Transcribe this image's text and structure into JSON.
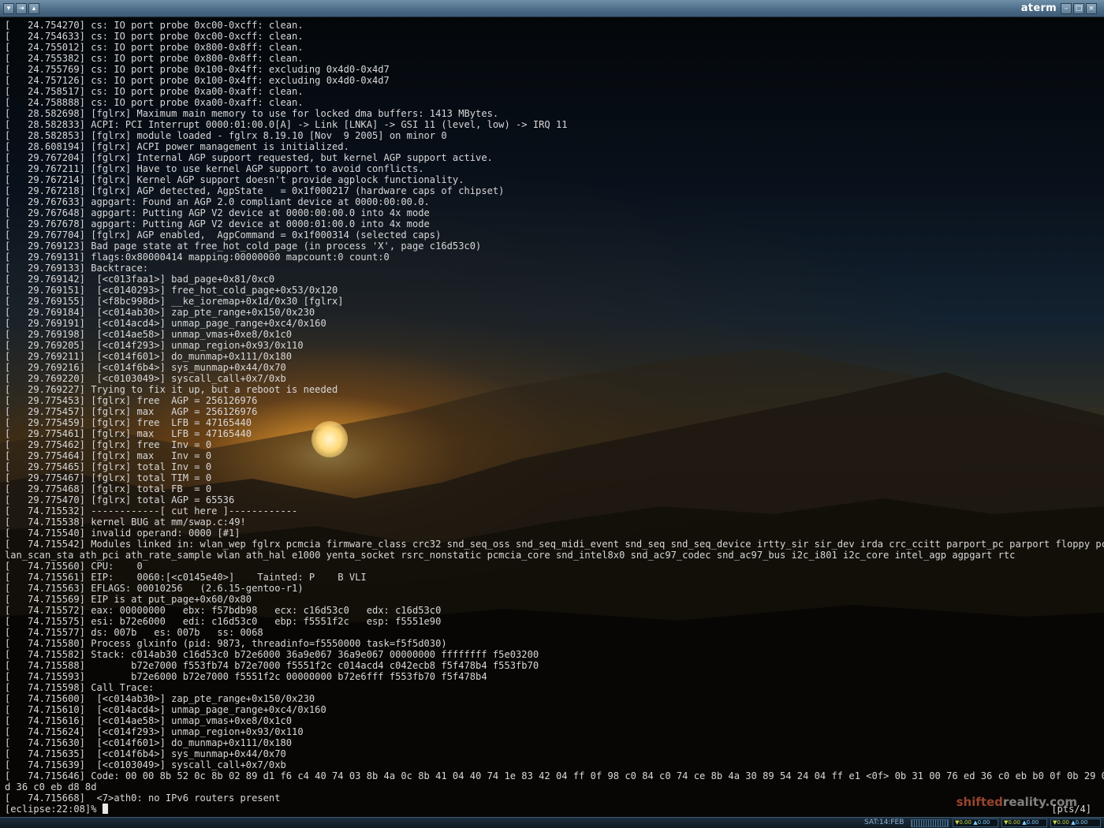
{
  "window": {
    "title": "aterm",
    "left_buttons": [
      "▾",
      "⇥",
      "▴"
    ],
    "right_buttons": [
      "–",
      "□",
      "×"
    ]
  },
  "terminal": {
    "lines": [
      "[   24.754270] cs: IO port probe 0xc00-0xcff: clean.",
      "[   24.754633] cs: IO port probe 0xc00-0xcff: clean.",
      "[   24.755012] cs: IO port probe 0x800-0x8ff: clean.",
      "[   24.755382] cs: IO port probe 0x800-0x8ff: clean.",
      "[   24.755769] cs: IO port probe 0x100-0x4ff: excluding 0x4d0-0x4d7",
      "[   24.757126] cs: IO port probe 0x100-0x4ff: excluding 0x4d0-0x4d7",
      "[   24.758517] cs: IO port probe 0xa00-0xaff: clean.",
      "[   24.758888] cs: IO port probe 0xa00-0xaff: clean.",
      "[   28.582698] [fglrx] Maximum main memory to use for locked dma buffers: 1413 MBytes.",
      "[   28.582833] ACPI: PCI Interrupt 0000:01:00.0[A] -> Link [LNKA] -> GSI 11 (level, low) -> IRQ 11",
      "[   28.582853] [fglrx] module loaded - fglrx 8.19.10 [Nov  9 2005] on minor 0",
      "[   28.608194] [fglrx] ACPI power management is initialized.",
      "[   29.767204] [fglrx] Internal AGP support requested, but kernel AGP support active.",
      "[   29.767211] [fglrx] Have to use kernel AGP support to avoid conflicts.",
      "[   29.767214] [fglrx] Kernel AGP support doesn't provide agplock functionality.",
      "[   29.767218] [fglrx] AGP detected, AgpState   = 0x1f000217 (hardware caps of chipset)",
      "[   29.767633] agpgart: Found an AGP 2.0 compliant device at 0000:00:00.0.",
      "[   29.767648] agpgart: Putting AGP V2 device at 0000:00:00.0 into 4x mode",
      "[   29.767678] agpgart: Putting AGP V2 device at 0000:01:00.0 into 4x mode",
      "[   29.767704] [fglrx] AGP enabled,  AgpCommand = 0x1f000314 (selected caps)",
      "[   29.769123] Bad page state at free_hot_cold_page (in process 'X', page c16d53c0)",
      "[   29.769131] flags:0x80000414 mapping:00000000 mapcount:0 count:0",
      "[   29.769133] Backtrace:",
      "[   29.769142]  [<c013faa1>] bad_page+0x81/0xc0",
      "[   29.769151]  [<c0140293>] free_hot_cold_page+0x53/0x120",
      "[   29.769155]  [<f8bc998d>] __ke_ioremap+0x1d/0x30 [fglrx]",
      "[   29.769184]  [<c014ab30>] zap_pte_range+0x150/0x230",
      "[   29.769191]  [<c014acd4>] unmap_page_range+0xc4/0x160",
      "[   29.769198]  [<c014ae58>] unmap_vmas+0xe8/0x1c0",
      "[   29.769205]  [<c014f293>] unmap_region+0x93/0x110",
      "[   29.769211]  [<c014f601>] do_munmap+0x111/0x180",
      "[   29.769216]  [<c014f6b4>] sys_munmap+0x44/0x70",
      "[   29.769220]  [<c0103049>] syscall_call+0x7/0xb",
      "[   29.769227] Trying to fix it up, but a reboot is needed",
      "[   29.775453] [fglrx] free  AGP = 256126976",
      "[   29.775457] [fglrx] max   AGP = 256126976",
      "[   29.775459] [fglrx] free  LFB = 47165440",
      "[   29.775461] [fglrx] max   LFB = 47165440",
      "[   29.775462] [fglrx] free  Inv = 0",
      "[   29.775464] [fglrx] max   Inv = 0",
      "[   29.775465] [fglrx] total Inv = 0",
      "[   29.775467] [fglrx] total TIM = 0",
      "[   29.775468] [fglrx] total FB  = 0",
      "[   29.775470] [fglrx] total AGP = 65536",
      "[   74.715532] ------------[ cut here ]------------",
      "[   74.715538] kernel BUG at mm/swap.c:49!",
      "[   74.715540] invalid operand: 0000 [#1]",
      "[   74.715542] Modules linked in: wlan_wep fglrx pcmcia firmware_class crc32 snd_seq_oss snd_seq_midi_event snd_seq snd_seq_device irtty_sir sir_dev irda crc_ccitt parport_pc parport floppy pcspkr w",
      "lan_scan_sta ath_pci ath_rate_sample wlan ath_hal e1000 yenta_socket rsrc_nonstatic pcmcia_core snd_intel8x0 snd_ac97_codec snd_ac97_bus i2c_i801 i2c_core intel_agp agpgart rtc",
      "[   74.715560] CPU:    0",
      "[   74.715561] EIP:    0060:[<c0145e40>]    Tainted: P    B VLI",
      "[   74.715563] EFLAGS: 00010256   (2.6.15-gentoo-r1)",
      "[   74.715569] EIP is at put_page+0x60/0x80",
      "[   74.715572] eax: 00000000   ebx: f57bdb98   ecx: c16d53c0   edx: c16d53c0",
      "[   74.715575] esi: b72e6000   edi: c16d53c0   ebp: f5551f2c   esp: f5551e90",
      "[   74.715577] ds: 007b   es: 007b   ss: 0068",
      "[   74.715580] Process glxinfo (pid: 9873, threadinfo=f5550000 task=f5f5d030)",
      "[   74.715582] Stack: c014ab30 c16d53c0 b72e6000 36a9e067 36a9e067 00000000 ffffffff f5e03200",
      "[   74.715588]        b72e7000 f553fb74 b72e7000 f5551f2c c014acd4 c042ecb8 f5f478b4 f553fb70",
      "[   74.715593]        b72e6000 b72e7000 f5551f2c 00000000 b72e6fff f553fb70 f5f478b4",
      "[   74.715598] Call Trace:",
      "[   74.715600]  [<c014ab30>] zap_pte_range+0x150/0x230",
      "[   74.715610]  [<c014acd4>] unmap_page_range+0xc4/0x160",
      "[   74.715616]  [<c014ae58>] unmap_vmas+0xe8/0x1c0",
      "[   74.715624]  [<c014f293>] unmap_region+0x93/0x110",
      "[   74.715630]  [<c014f601>] do_munmap+0x111/0x180",
      "[   74.715635]  [<c014f6b4>] sys_munmap+0x44/0x70",
      "[   74.715639]  [<c0103049>] syscall_call+0x7/0xb",
      "[   74.715646] Code: 00 00 8b 52 0c 8b 02 89 d1 f6 c4 40 74 03 8b 4a 0c 8b 41 04 40 74 1e 83 42 04 ff 0f 98 c0 84 c0 74 ce 8b 4a 30 89 54 24 04 ff e1 <0f> 0b 31 00 76 ed 36 c0 eb b0 0f 0b 29 00 76 e",
      "d 36 c0 eb d8 8d",
      "[   74.715668]  <7>ath0: no IPv6 routers present"
    ],
    "prompt": "[eclipse:22:08]% ",
    "tty": "[pts/4]"
  },
  "watermark": {
    "part1": "shifted",
    "part2": "reality.com"
  },
  "panel": {
    "clock": "SAT:14:FEB",
    "meters": [
      {
        "a": "▼0.00",
        "b": "▲0.00"
      },
      {
        "a": "▼0.00",
        "b": "▲0.00"
      },
      {
        "a": "▼0.00",
        "b": "▲0.00"
      }
    ]
  },
  "colors": {
    "terminal_text": "#d8d8d8",
    "titlebar": "#4d6d88",
    "sun": "#ffd878"
  }
}
